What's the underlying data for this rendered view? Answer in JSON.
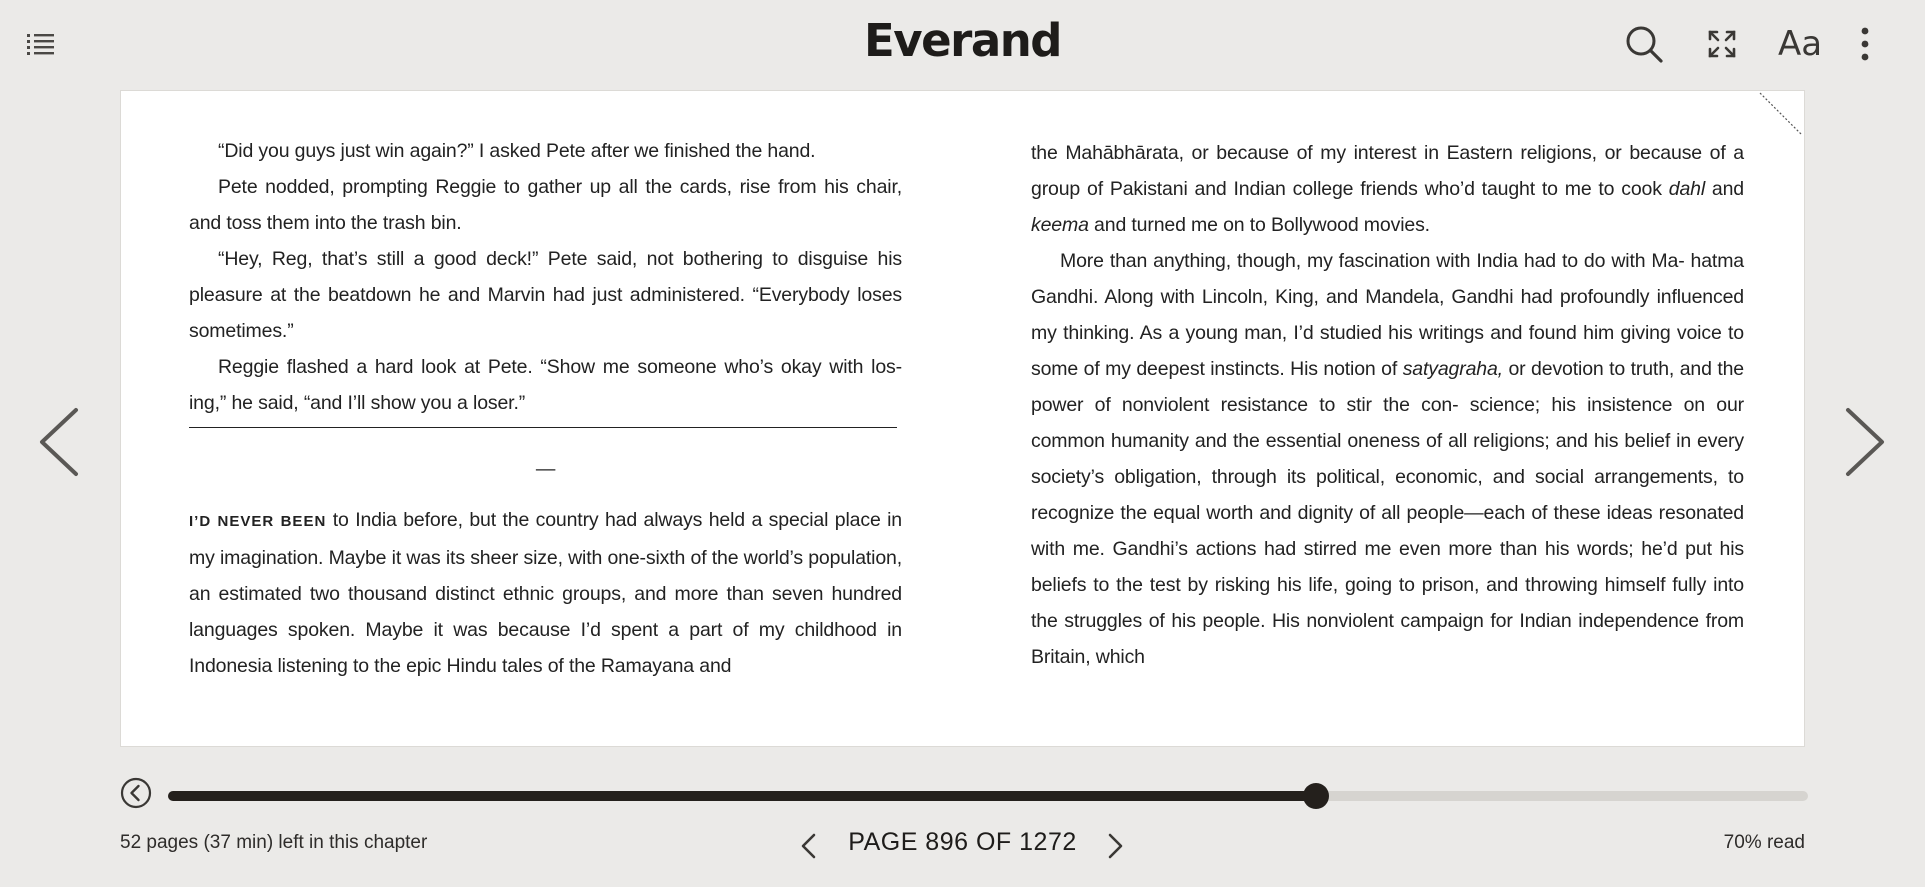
{
  "app": {
    "logo": "Everand"
  },
  "toolbar": {
    "toc_icon": "list-icon",
    "search_icon": "search-icon",
    "fullscreen_icon": "expand-icon",
    "font_settings_label": "Aa",
    "more_icon": "more-vertical-icon"
  },
  "page": {
    "left": {
      "p1": "“Did you guys just win again?” I asked Pete after we finished the hand.",
      "p2": "Pete nodded, prompting Reggie to gather up all the cards, rise from his chair, and toss them into the trash bin.",
      "p3": "“Hey, Reg, that’s still a good deck!” Pete said, not bothering to disguise his pleasure at the beatdown he and Marvin had just administered. “Everybody loses sometimes.”",
      "p4": "Reggie flashed a hard look at Pete. “Show me someone who’s okay with los- ing,” he said, “and I’ll show you a loser.”",
      "separator": "—",
      "p5_lead": "I’d never been",
      "p5_rest": " to India before, but the country had always held a special place in my imagination. Maybe it was its sheer size, with one-sixth of the world’s population, an estimated two thousand distinct ethnic groups, and more than seven hundred languages spoken. Maybe it was because I’d spent a part of my childhood in Indonesia listening to the epic Hindu tales of the Ramayana and"
    },
    "right": {
      "p1_a": "the Mahābhārata, or because of my interest in Eastern religions, or because of a group of Pakistani and Indian college friends who’d taught to me to cook ",
      "p1_dahl": "dahl",
      "p1_b": " and ",
      "p1_keema": "keema",
      "p1_c": " and turned me on to Bollywood movies.",
      "p2_a": "More than anything, though, my fascination with India had to do with Ma- hatma Gandhi. Along with Lincoln, King, and Mandela, Gandhi had profoundly influenced my thinking. As a young man, I’d studied his writings and found him giving voice to some of my deepest instincts. His notion of ",
      "p2_term": "satyagraha,",
      "p2_b": " or devotion to truth, and the power of nonviolent resistance to stir the con- science; his insistence on our common humanity and the essential oneness of all religions; and his belief in every society’s obligation, through its political, economic, and social arrangements, to recognize the equal worth and dignity of all people—each of these ideas resonated with me. Gandhi’s actions had stirred me even more than his words; he’d put his beliefs to the test by risking his life, going to prison, and throwing himself fully into the struggles of his people. His nonviolent campaign for Indian independence from Britain, which"
    }
  },
  "navigation": {
    "prev_icon": "chevron-left-icon",
    "next_icon": "chevron-right-icon"
  },
  "progress": {
    "fraction": 0.7,
    "chapter_remaining": "52 pages (37 min) left in this chapter",
    "page_label": "PAGE 896 OF 1272",
    "percent_label": "70% read"
  }
}
